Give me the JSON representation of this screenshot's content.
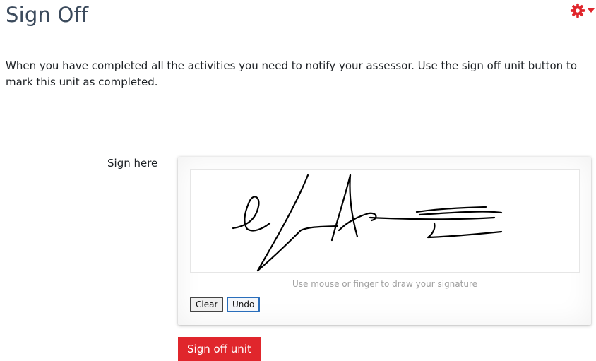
{
  "header": {
    "title": "Sign Off",
    "menu_icon": "gear-icon",
    "menu_color": "#e0262c"
  },
  "intro": {
    "text": "When you have completed all the activities you need to notify your assessor. Use the sign off unit button to mark this unit as completed."
  },
  "signature": {
    "label": "Sign here",
    "hint": "Use mouse or finger to draw your signature",
    "clear_label": "Clear",
    "undo_label": "Undo"
  },
  "actions": {
    "submit_label": "Sign off unit",
    "submit_color": "#e0262c"
  }
}
